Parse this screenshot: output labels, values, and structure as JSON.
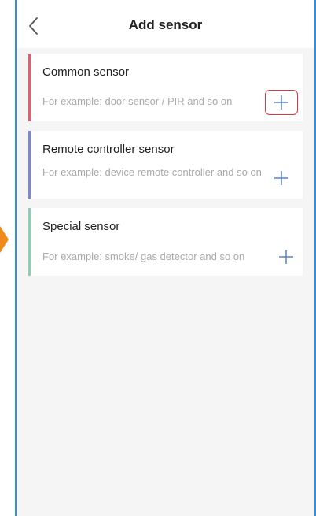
{
  "header": {
    "title": "Add sensor"
  },
  "sensors": [
    {
      "name": "Common sensor",
      "description": "For example: door sensor / PIR and so on",
      "accent": "#e06070"
    },
    {
      "name": "Remote controller sensor",
      "description": "For example: device remote controller and so on",
      "accent": "#7b88d0"
    },
    {
      "name": "Special sensor",
      "description": "For example: smoke/ gas detector and so on",
      "accent": "#8ccfb0"
    }
  ],
  "colors": {
    "arrow": "#f08a1c",
    "frame": "#2f8fe0",
    "highlight": "#e03545",
    "plus": "#5a82c8"
  },
  "icons": {
    "back": "chevron-left-icon",
    "add": "plus-icon"
  }
}
